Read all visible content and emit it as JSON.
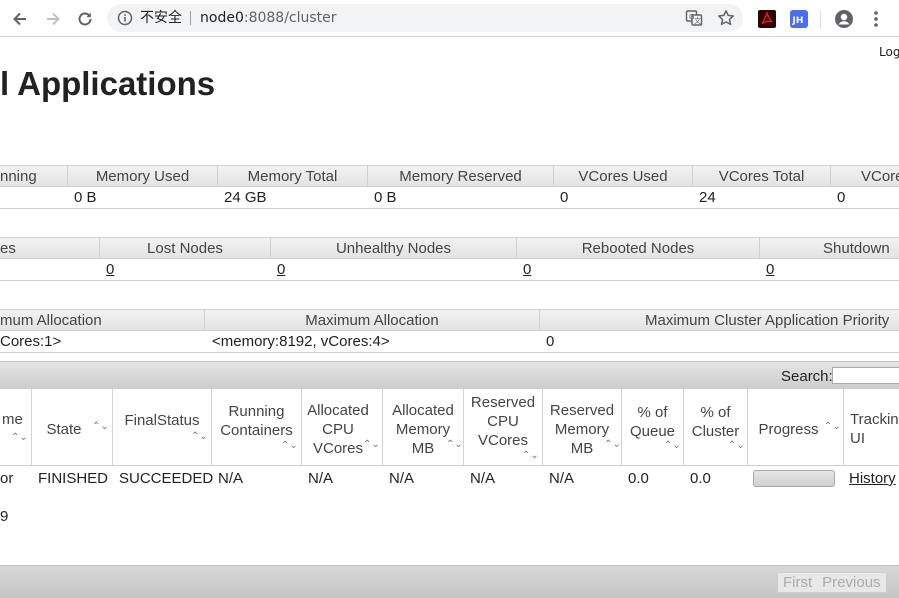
{
  "browser": {
    "security_label": "不安全",
    "url_host": "node0",
    "url_rest": ":8088/cluster"
  },
  "page": {
    "logged_in": "Log",
    "heading": "l Applications"
  },
  "cluster_metrics": {
    "headers": [
      "nning",
      "Memory Used",
      "Memory Total",
      "Memory Reserved",
      "VCores Used",
      "VCores Total",
      "VCore"
    ],
    "values": [
      "",
      "0 B",
      "24 GB",
      "0 B",
      "0",
      "24",
      "0"
    ]
  },
  "node_metrics": {
    "headers": [
      "es",
      "Lost Nodes",
      "Unhealthy Nodes",
      "Rebooted Nodes",
      "Shutdown"
    ],
    "values": [
      "",
      "0",
      "0",
      "0",
      "0"
    ]
  },
  "scheduler_metrics": {
    "headers": [
      "mum Allocation",
      "Maximum Allocation",
      "Maximum Cluster Application Priority"
    ],
    "values": [
      "Cores:1>",
      "<memory:8192, vCores:4>",
      "0"
    ]
  },
  "apps_table": {
    "search_label": "Search:",
    "search_value": "",
    "columns": [
      "me",
      "State",
      "FinalStatus",
      "Running\nContainers",
      "Allocated\nCPU\nVCores",
      "Allocated\nMemory\nMB",
      "Reserved\nCPU\nVCores",
      "Reserved\nMemory\nMB",
      "% of\nQueue",
      "% of\nCluster",
      "Progress",
      "Trackin\nUI"
    ],
    "row": {
      "name": "or",
      "state": "FINISHED",
      "final_status": "SUCCEEDED",
      "running_containers": "N/A",
      "allocated_cpu": "N/A",
      "allocated_memory": "N/A",
      "reserved_cpu": "N/A",
      "reserved_memory": "N/A",
      "pct_queue": "0.0",
      "pct_cluster": "0.0",
      "progress": 0,
      "tracking_ui": "History"
    },
    "info_text": "9",
    "pager": {
      "first": "First",
      "previous": "Previous"
    }
  },
  "colors": {
    "header_bg": "#e8e8e8",
    "border": "#cfcfcf",
    "pdf_icon": "#b30b00",
    "ext_icon": "#4a6cf7"
  }
}
